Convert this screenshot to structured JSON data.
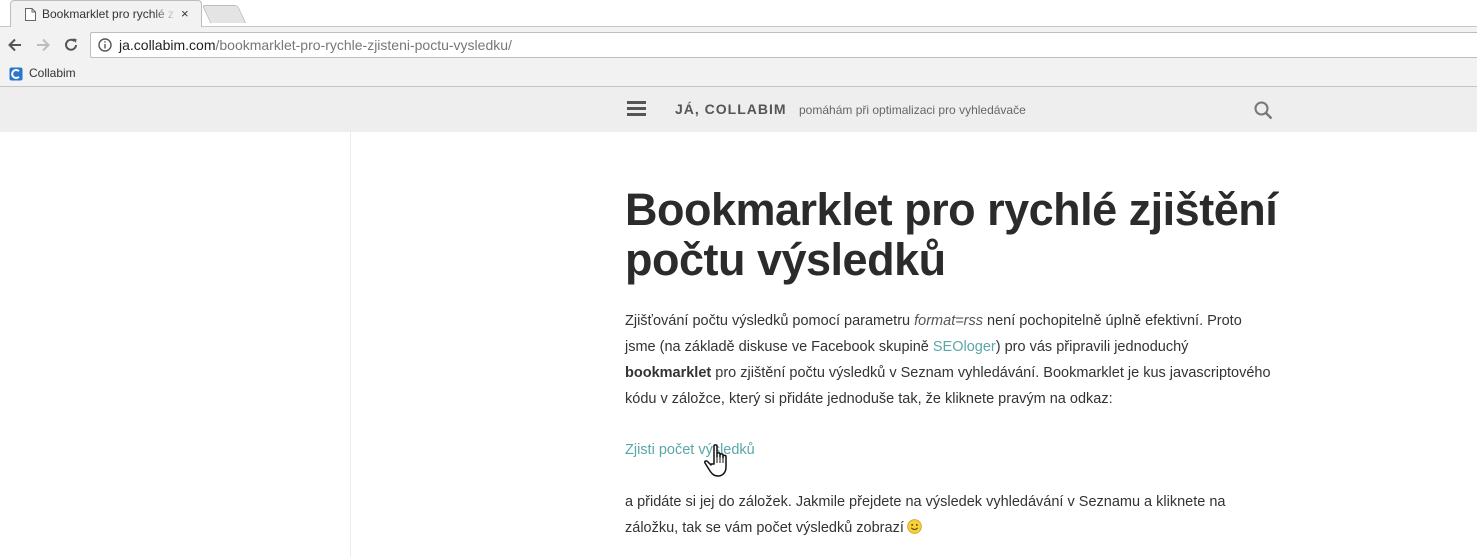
{
  "browser": {
    "tab_title": "Bookmarklet pro rychlé z",
    "tab_close": "×",
    "url_host": "ja.collabim.com",
    "url_path": "/bookmarklet-pro-rychle-zjisteni-poctu-vysledku/",
    "bookmark_label": "Collabim"
  },
  "site": {
    "title": "JÁ, COLLABIM",
    "tagline": "pomáhám při optimalizaci pro vyhledávače"
  },
  "post": {
    "title": "Bookmarklet pro rychlé zjištění\npočtu výsledků",
    "p1_a": "Zjišťování počtu výsledků pomocí parametru ",
    "p1_em": "format=rss",
    "p1_b": " není pochopitelně úplně efektivní. Proto jsme (na základě diskuse ve Facebook skupině ",
    "p1_link": "SEOloger",
    "p1_c": ") pro vás připravili jednoduchý ",
    "p1_strong": "bookmarklet",
    "p1_d": " pro zjištění počtu výsledků v Seznam vyhledávání. Bookmarklet je kus javascriptového kódu v záložce, který si přidáte jednoduše tak, že kliknete pravým na odkaz:",
    "bookmarklet_link": "Zjisti počet výsledků",
    "p3": "a přidáte si jej do záložek. Jakmile přejdete na výsledek vyhledávání v Seznamu a kliknete na záložku, tak se vám počet výsledků zobrazí"
  },
  "colors": {
    "link": "#5aa7a7",
    "header_bg": "#eeeeee",
    "chrome_bg": "#f2f2f2"
  }
}
